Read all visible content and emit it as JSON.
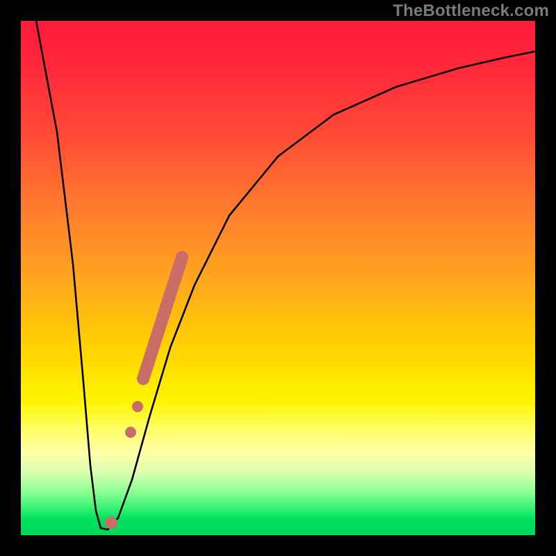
{
  "watermark": "TheBottleneck.com",
  "chart_data": {
    "type": "line",
    "title": "",
    "xlabel": "",
    "ylabel": "",
    "xlim": [
      0,
      100
    ],
    "ylim": [
      0,
      100
    ],
    "grid": false,
    "series": [
      {
        "name": "curve",
        "x": [
          3,
          5,
          7,
          9,
          11,
          13,
          15,
          17,
          20,
          24,
          28,
          32,
          38,
          45,
          55,
          65,
          75,
          85,
          95,
          100
        ],
        "y": [
          100,
          70,
          40,
          15,
          3,
          1,
          2,
          8,
          20,
          35,
          48,
          58,
          68,
          76,
          83,
          87,
          90,
          92.5,
          94,
          95
        ]
      }
    ],
    "markers": [
      {
        "name": "bottom-dot",
        "x": 14.5,
        "y": 2,
        "r": 1.2
      },
      {
        "name": "mid-dot-1",
        "x": 20.5,
        "y": 20,
        "r": 1.2
      },
      {
        "name": "mid-dot-2",
        "x": 22.0,
        "y": 25,
        "r": 1.2
      }
    ],
    "bar_segment": {
      "name": "thick-segment",
      "x0": 23.5,
      "y0": 30,
      "x1": 30.5,
      "y1": 54,
      "width": 2.5
    },
    "colors": {
      "curve": "#000000",
      "marker": "#c96d66",
      "bg_top": "#ff1a3a",
      "bg_bottom": "#00d856"
    }
  }
}
